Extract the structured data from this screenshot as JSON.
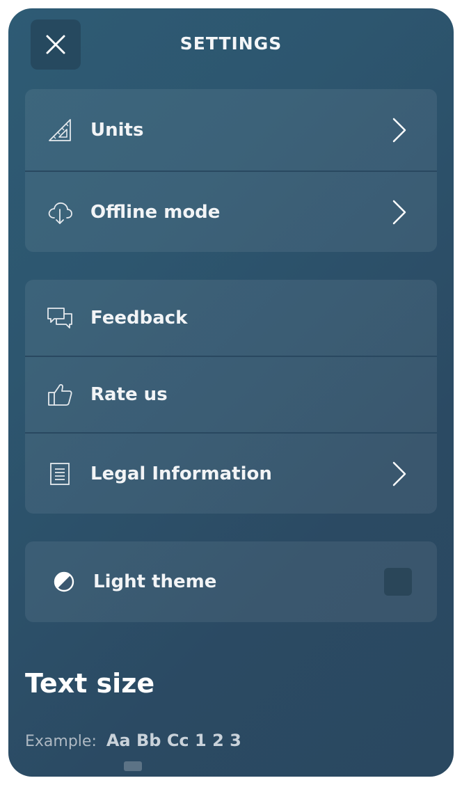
{
  "header": {
    "title": "SETTINGS",
    "close_icon": "close-icon"
  },
  "groups": {
    "units": {
      "label": "Units",
      "icon": "ruler-triangle-icon"
    },
    "offline": {
      "label": "Offline mode",
      "icon": "cloud-download-icon"
    },
    "feedback": {
      "label": "Feedback",
      "icon": "chat-bubbles-icon"
    },
    "rate": {
      "label": "Rate us",
      "icon": "thumbs-up-icon"
    },
    "legal": {
      "label": "Legal Information",
      "icon": "document-icon"
    }
  },
  "theme": {
    "label": "Light theme",
    "icon": "contrast-icon",
    "checked": false
  },
  "text_size": {
    "title": "Text size",
    "example_label": "Example:",
    "example_text": "Aa Bb Cc 1 2 3"
  },
  "colors": {
    "panel_top": "#2e5b74",
    "panel_bottom": "#2a4860",
    "text": "#f2f4f6"
  }
}
